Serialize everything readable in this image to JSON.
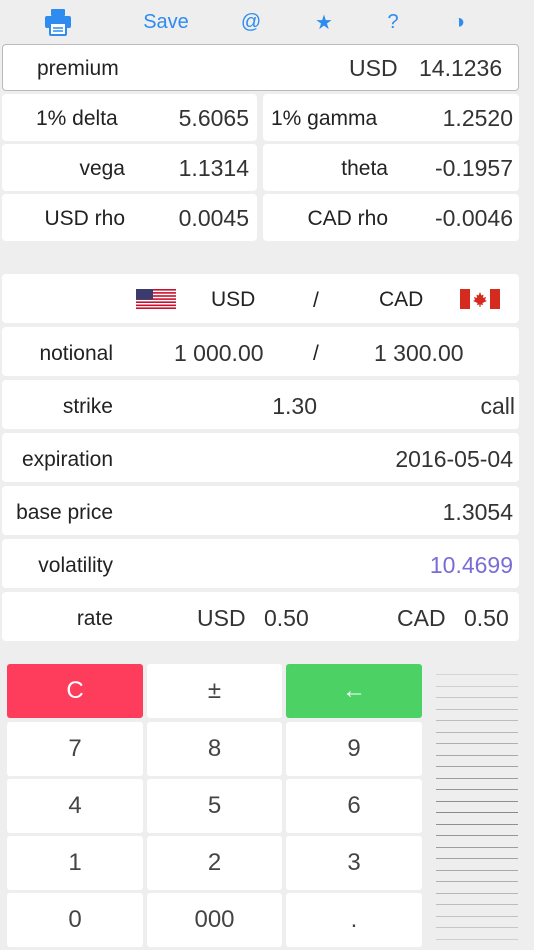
{
  "toolbar": {
    "print_icon": "printer-icon",
    "save_label": "Save",
    "email_label": "@",
    "favorite_label": "★",
    "help_label": "?",
    "theme_label": "◑"
  },
  "colors": {
    "accent": "#2e8cf0",
    "clear_key": "#fd3d5b",
    "backspace_key": "#4cd264",
    "volatility_text": "#7a6cd6"
  },
  "premium": {
    "label": "premium",
    "currency": "USD",
    "value": "14.1236"
  },
  "greeks": {
    "delta_label": "1% delta",
    "delta_value": "5.6065",
    "gamma_label": "1% gamma",
    "gamma_value": "1.2520",
    "vega_label": "vega",
    "vega_value": "1.1314",
    "theta_label": "theta",
    "theta_value": "-0.1957",
    "rho_base_label": "USD rho",
    "rho_base_value": "0.0045",
    "rho_quote_label": "CAD rho",
    "rho_quote_value": "-0.0046"
  },
  "pair": {
    "base": "USD",
    "separator": "/",
    "quote": "CAD",
    "base_flag": "us-flag-icon",
    "quote_flag": "canada-flag-icon"
  },
  "notional": {
    "label": "notional",
    "base_value": "1 000.00",
    "separator": "/",
    "quote_value": "1 300.00"
  },
  "strike": {
    "label": "strike",
    "value": "1.30",
    "type": "call"
  },
  "expiration": {
    "label": "expiration",
    "value": "2016-05-04"
  },
  "base_price": {
    "label": "base price",
    "value": "1.3054"
  },
  "volatility": {
    "label": "volatility",
    "value": "10.4699"
  },
  "rate": {
    "label": "rate",
    "base_currency": "USD",
    "base_value": "0.50",
    "quote_currency": "CAD",
    "quote_value": "0.50"
  },
  "keypad": {
    "clear": "C",
    "plus_minus": "±",
    "backspace": "←",
    "k7": "7",
    "k8": "8",
    "k9": "9",
    "k4": "4",
    "k5": "5",
    "k6": "6",
    "k1": "1",
    "k2": "2",
    "k3": "3",
    "k0": "0",
    "k000": "000",
    "dot": "."
  }
}
